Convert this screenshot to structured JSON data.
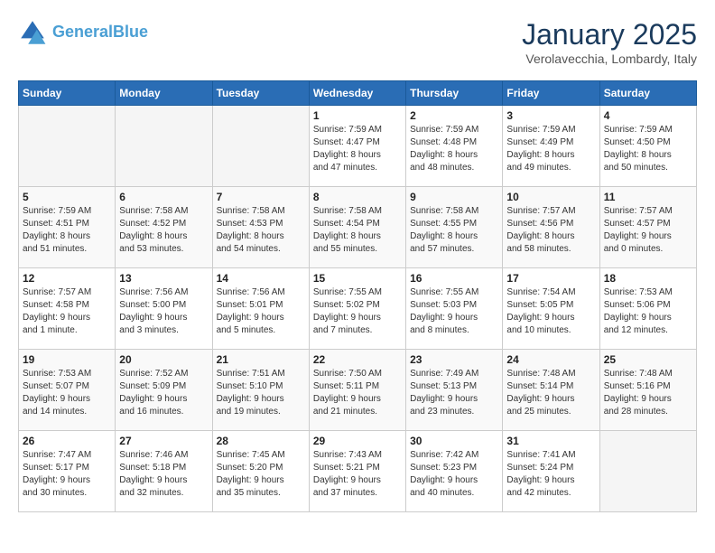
{
  "header": {
    "logo_line1": "General",
    "logo_line2": "Blue",
    "title": "January 2025",
    "subtitle": "Verolavecchia, Lombardy, Italy"
  },
  "weekdays": [
    "Sunday",
    "Monday",
    "Tuesday",
    "Wednesday",
    "Thursday",
    "Friday",
    "Saturday"
  ],
  "weeks": [
    [
      {
        "day": "",
        "info": ""
      },
      {
        "day": "",
        "info": ""
      },
      {
        "day": "",
        "info": ""
      },
      {
        "day": "1",
        "info": "Sunrise: 7:59 AM\nSunset: 4:47 PM\nDaylight: 8 hours\nand 47 minutes."
      },
      {
        "day": "2",
        "info": "Sunrise: 7:59 AM\nSunset: 4:48 PM\nDaylight: 8 hours\nand 48 minutes."
      },
      {
        "day": "3",
        "info": "Sunrise: 7:59 AM\nSunset: 4:49 PM\nDaylight: 8 hours\nand 49 minutes."
      },
      {
        "day": "4",
        "info": "Sunrise: 7:59 AM\nSunset: 4:50 PM\nDaylight: 8 hours\nand 50 minutes."
      }
    ],
    [
      {
        "day": "5",
        "info": "Sunrise: 7:59 AM\nSunset: 4:51 PM\nDaylight: 8 hours\nand 51 minutes."
      },
      {
        "day": "6",
        "info": "Sunrise: 7:58 AM\nSunset: 4:52 PM\nDaylight: 8 hours\nand 53 minutes."
      },
      {
        "day": "7",
        "info": "Sunrise: 7:58 AM\nSunset: 4:53 PM\nDaylight: 8 hours\nand 54 minutes."
      },
      {
        "day": "8",
        "info": "Sunrise: 7:58 AM\nSunset: 4:54 PM\nDaylight: 8 hours\nand 55 minutes."
      },
      {
        "day": "9",
        "info": "Sunrise: 7:58 AM\nSunset: 4:55 PM\nDaylight: 8 hours\nand 57 minutes."
      },
      {
        "day": "10",
        "info": "Sunrise: 7:57 AM\nSunset: 4:56 PM\nDaylight: 8 hours\nand 58 minutes."
      },
      {
        "day": "11",
        "info": "Sunrise: 7:57 AM\nSunset: 4:57 PM\nDaylight: 9 hours\nand 0 minutes."
      }
    ],
    [
      {
        "day": "12",
        "info": "Sunrise: 7:57 AM\nSunset: 4:58 PM\nDaylight: 9 hours\nand 1 minute."
      },
      {
        "day": "13",
        "info": "Sunrise: 7:56 AM\nSunset: 5:00 PM\nDaylight: 9 hours\nand 3 minutes."
      },
      {
        "day": "14",
        "info": "Sunrise: 7:56 AM\nSunset: 5:01 PM\nDaylight: 9 hours\nand 5 minutes."
      },
      {
        "day": "15",
        "info": "Sunrise: 7:55 AM\nSunset: 5:02 PM\nDaylight: 9 hours\nand 7 minutes."
      },
      {
        "day": "16",
        "info": "Sunrise: 7:55 AM\nSunset: 5:03 PM\nDaylight: 9 hours\nand 8 minutes."
      },
      {
        "day": "17",
        "info": "Sunrise: 7:54 AM\nSunset: 5:05 PM\nDaylight: 9 hours\nand 10 minutes."
      },
      {
        "day": "18",
        "info": "Sunrise: 7:53 AM\nSunset: 5:06 PM\nDaylight: 9 hours\nand 12 minutes."
      }
    ],
    [
      {
        "day": "19",
        "info": "Sunrise: 7:53 AM\nSunset: 5:07 PM\nDaylight: 9 hours\nand 14 minutes."
      },
      {
        "day": "20",
        "info": "Sunrise: 7:52 AM\nSunset: 5:09 PM\nDaylight: 9 hours\nand 16 minutes."
      },
      {
        "day": "21",
        "info": "Sunrise: 7:51 AM\nSunset: 5:10 PM\nDaylight: 9 hours\nand 19 minutes."
      },
      {
        "day": "22",
        "info": "Sunrise: 7:50 AM\nSunset: 5:11 PM\nDaylight: 9 hours\nand 21 minutes."
      },
      {
        "day": "23",
        "info": "Sunrise: 7:49 AM\nSunset: 5:13 PM\nDaylight: 9 hours\nand 23 minutes."
      },
      {
        "day": "24",
        "info": "Sunrise: 7:48 AM\nSunset: 5:14 PM\nDaylight: 9 hours\nand 25 minutes."
      },
      {
        "day": "25",
        "info": "Sunrise: 7:48 AM\nSunset: 5:16 PM\nDaylight: 9 hours\nand 28 minutes."
      }
    ],
    [
      {
        "day": "26",
        "info": "Sunrise: 7:47 AM\nSunset: 5:17 PM\nDaylight: 9 hours\nand 30 minutes."
      },
      {
        "day": "27",
        "info": "Sunrise: 7:46 AM\nSunset: 5:18 PM\nDaylight: 9 hours\nand 32 minutes."
      },
      {
        "day": "28",
        "info": "Sunrise: 7:45 AM\nSunset: 5:20 PM\nDaylight: 9 hours\nand 35 minutes."
      },
      {
        "day": "29",
        "info": "Sunrise: 7:43 AM\nSunset: 5:21 PM\nDaylight: 9 hours\nand 37 minutes."
      },
      {
        "day": "30",
        "info": "Sunrise: 7:42 AM\nSunset: 5:23 PM\nDaylight: 9 hours\nand 40 minutes."
      },
      {
        "day": "31",
        "info": "Sunrise: 7:41 AM\nSunset: 5:24 PM\nDaylight: 9 hours\nand 42 minutes."
      },
      {
        "day": "",
        "info": ""
      }
    ]
  ]
}
